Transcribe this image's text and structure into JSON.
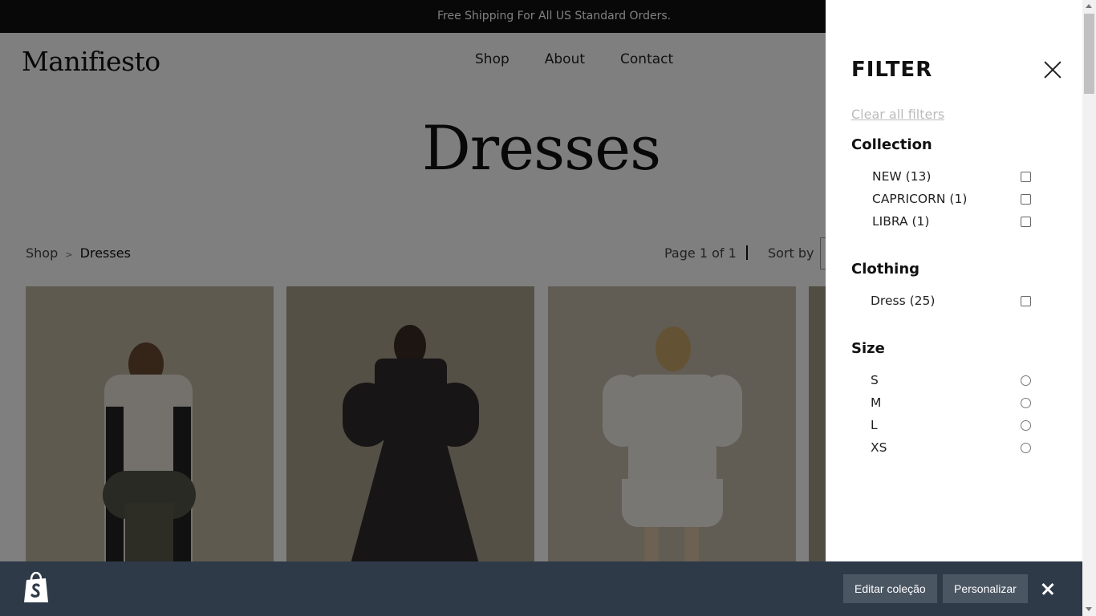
{
  "announcement": "Free Shipping For All US Standard Orders.",
  "logo": "Manifiesto",
  "nav": [
    "Shop",
    "About",
    "Contact"
  ],
  "page_title": "Dresses",
  "breadcrumb": {
    "root": "Shop",
    "separator": ">",
    "current": "Dresses"
  },
  "pagination": "Page 1 of 1",
  "sort_label": "Sort by",
  "filter": {
    "title": "FILTER",
    "clear_all": "Clear all filters",
    "collection": {
      "title": "Collection",
      "options": [
        "NEW (13)",
        "CAPRICORN (1)",
        "LIBRA (1)"
      ]
    },
    "clothing": {
      "title": "Clothing",
      "options": [
        "Dress (25)"
      ]
    },
    "size": {
      "title": "Size",
      "options": [
        "S",
        "M",
        "L",
        "XS"
      ]
    }
  },
  "admin_bar": {
    "edit_collection": "Editar coleção",
    "customize": "Personalizar"
  },
  "colors": {
    "announcement_bg": "#111111",
    "admin_bar_bg": "#2f3a48",
    "admin_button_bg": "#4b5663",
    "overlay": "rgba(0,0,0,0.5)"
  }
}
